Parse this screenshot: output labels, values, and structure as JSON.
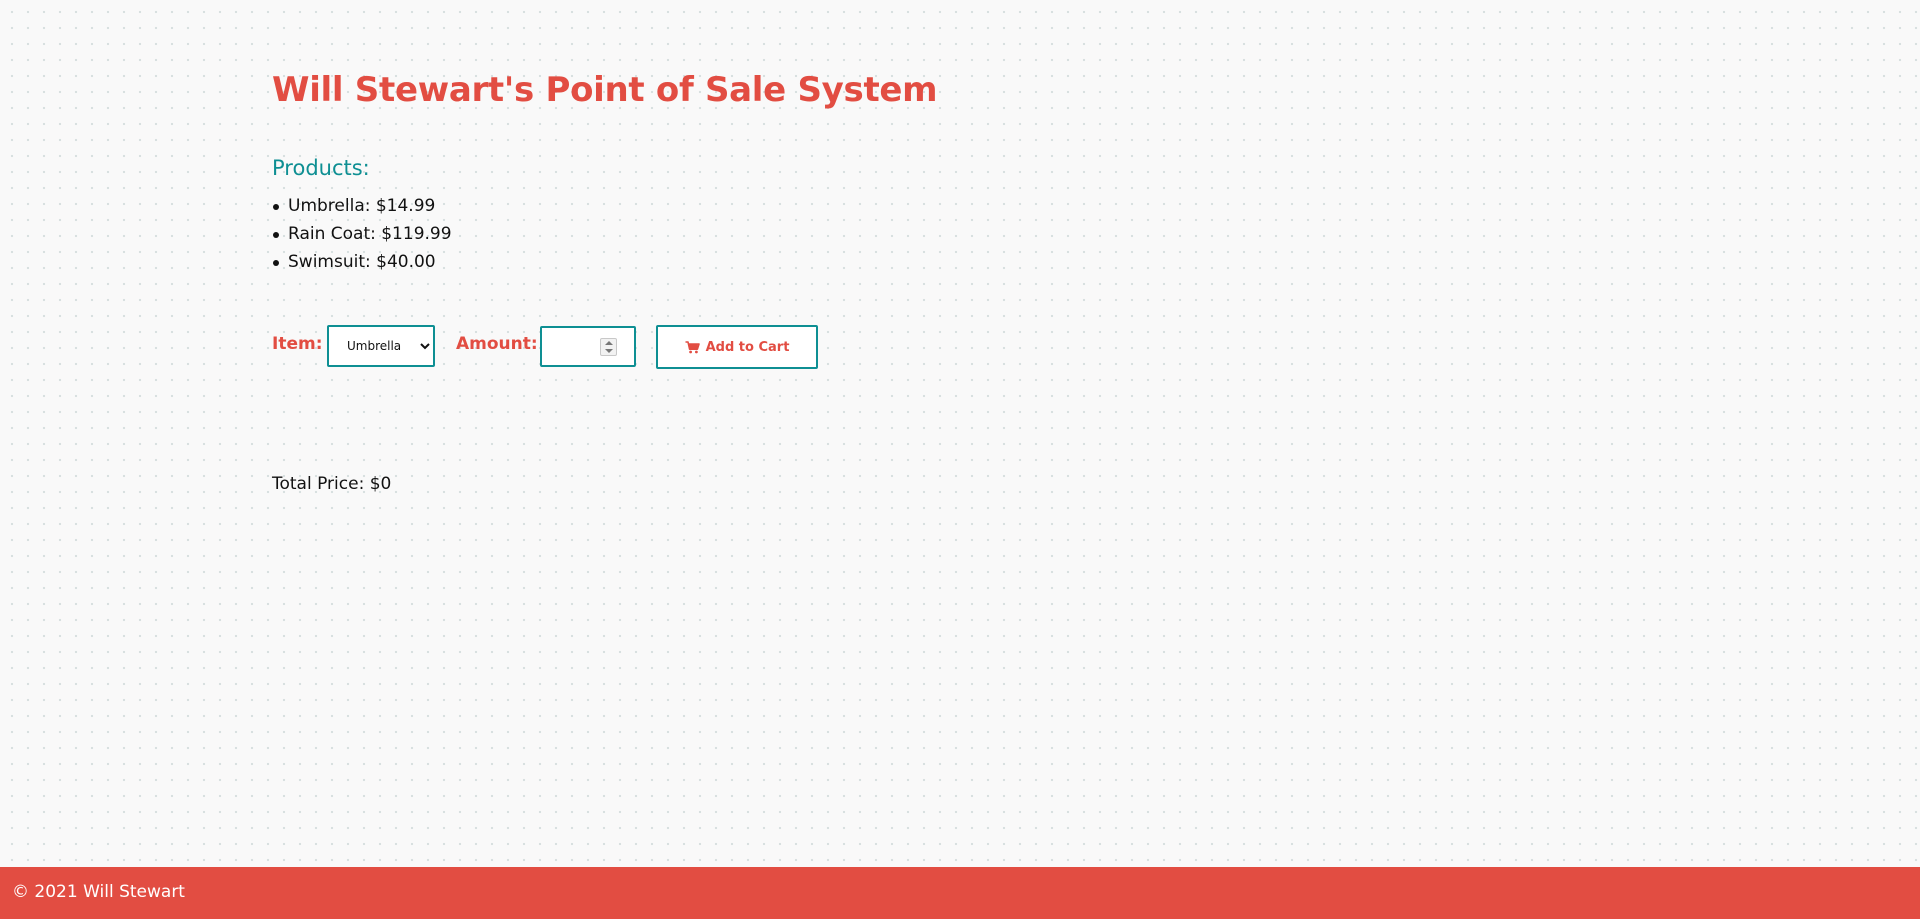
{
  "page": {
    "title": "Will Stewart's Point of Sale System"
  },
  "products": {
    "heading": "Products:",
    "items": [
      "Umbrella: $14.99",
      "Rain Coat: $119.99",
      "Swimsuit: $40.00"
    ]
  },
  "form": {
    "item_label": "Item:",
    "item_selected": "Umbrella",
    "amount_label": "Amount:",
    "amount_value": "",
    "add_button_label": "Add to Cart",
    "add_button_icon": "shopping-cart-icon"
  },
  "total": {
    "text": "Total Price: $0"
  },
  "footer": {
    "text": "© 2021 Will Stewart"
  },
  "colors": {
    "accent": "#e24d42",
    "teal": "#0e8f93",
    "background": "#f9f9f9"
  }
}
